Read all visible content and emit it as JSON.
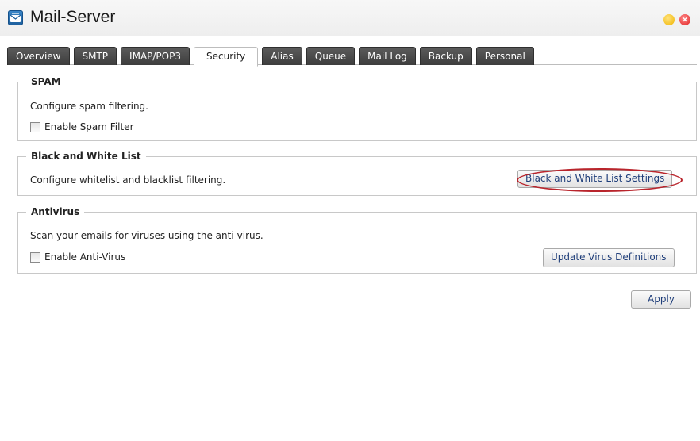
{
  "window": {
    "title": "Mail-Server",
    "app_icon": "mail-server-icon",
    "controls": [
      "minimize-icon",
      "close-icon"
    ],
    "accent_colors": {
      "minimize": "#f0b400",
      "close": "#e02020"
    }
  },
  "tabs": [
    {
      "label": "Overview"
    },
    {
      "label": "SMTP"
    },
    {
      "label": "IMAP/POP3"
    },
    {
      "label": "Security",
      "active": true
    },
    {
      "label": "Alias"
    },
    {
      "label": "Queue"
    },
    {
      "label": "Mail Log"
    },
    {
      "label": "Backup"
    },
    {
      "label": "Personal"
    }
  ],
  "spam": {
    "legend": "SPAM",
    "description": "Configure spam filtering.",
    "checkbox_label": "Enable Spam Filter",
    "checked": false
  },
  "bwlist": {
    "legend": "Black and White List",
    "description": "Configure whitelist and blacklist filtering.",
    "button_label": "Black and White List Settings",
    "highlight_color": "#b9252c"
  },
  "antivirus": {
    "legend": "Antivirus",
    "description": "Scan your emails for viruses using the anti-virus.",
    "checkbox_label": "Enable Anti-Virus",
    "checked": false,
    "button_label": "Update Virus Definitions"
  },
  "footer": {
    "apply_label": "Apply"
  }
}
